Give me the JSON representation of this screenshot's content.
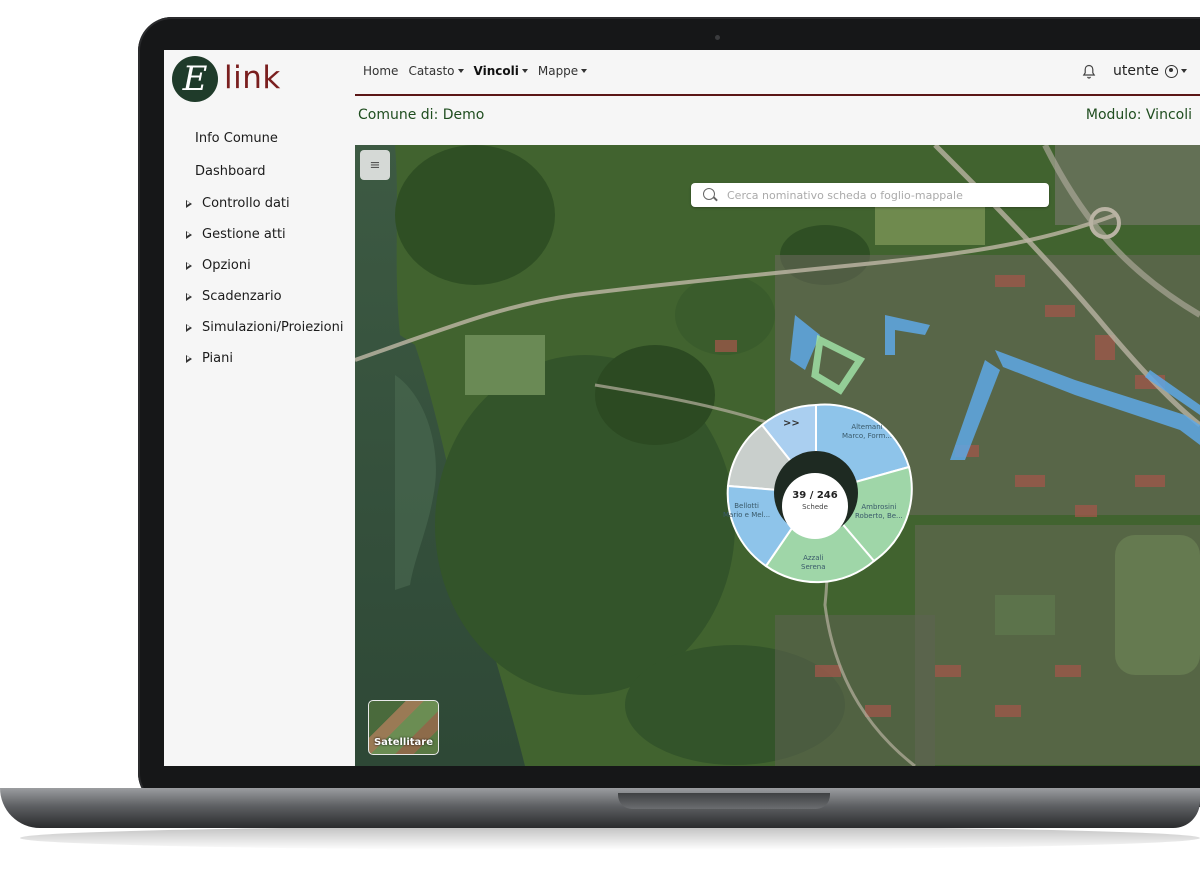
{
  "app": {
    "logo_letter": "E",
    "logo_text": "link"
  },
  "sidebar": {
    "items": [
      {
        "label": "Info Comune",
        "expandable": false
      },
      {
        "label": "Dashboard",
        "expandable": false
      },
      {
        "label": "Controllo dati",
        "expandable": true
      },
      {
        "label": "Gestione atti",
        "expandable": true
      },
      {
        "label": "Opzioni",
        "expandable": true
      },
      {
        "label": "Scadenzario",
        "expandable": true
      },
      {
        "label": "Simulazioni/Proiezioni",
        "expandable": true
      },
      {
        "label": "Piani",
        "expandable": true
      }
    ]
  },
  "nav": {
    "items": [
      {
        "label": "Home",
        "dropdown": false,
        "active": false
      },
      {
        "label": "Catasto",
        "dropdown": true,
        "active": false
      },
      {
        "label": "Vincoli",
        "dropdown": true,
        "active": true
      },
      {
        "label": "Mappe",
        "dropdown": true,
        "active": false
      }
    ],
    "user": "utente",
    "bell_icon": "bell-icon",
    "user_icon": "user-circle-icon"
  },
  "header": {
    "comune": "Comune di: Demo",
    "modulo": "Modulo: Vincoli"
  },
  "map": {
    "menu_icon": "hamburger-icon",
    "search_placeholder": "Cerca nominativo scheda o foglio-mappale",
    "layer_button": "Satellitare",
    "pie": {
      "count": "39 / 246",
      "sublabel": "Schede",
      "more_label": ">>",
      "segments": [
        {
          "line1": "Altemani",
          "line2": "Marco, Form...",
          "color": "#8ec4ea"
        },
        {
          "line1": "Ambrosini",
          "line2": "Roberto, Be...",
          "color": "#9fd6a8"
        },
        {
          "line1": "Azzali",
          "line2": "Serena",
          "color": "#9fd6a8"
        },
        {
          "line1": "Bellotti",
          "line2": "Mario e Mel...",
          "color": "#8ec4ea"
        }
      ]
    },
    "colors": {
      "highlight_blue": "#5ea8e6",
      "highlight_green": "#9fe0a6"
    }
  }
}
